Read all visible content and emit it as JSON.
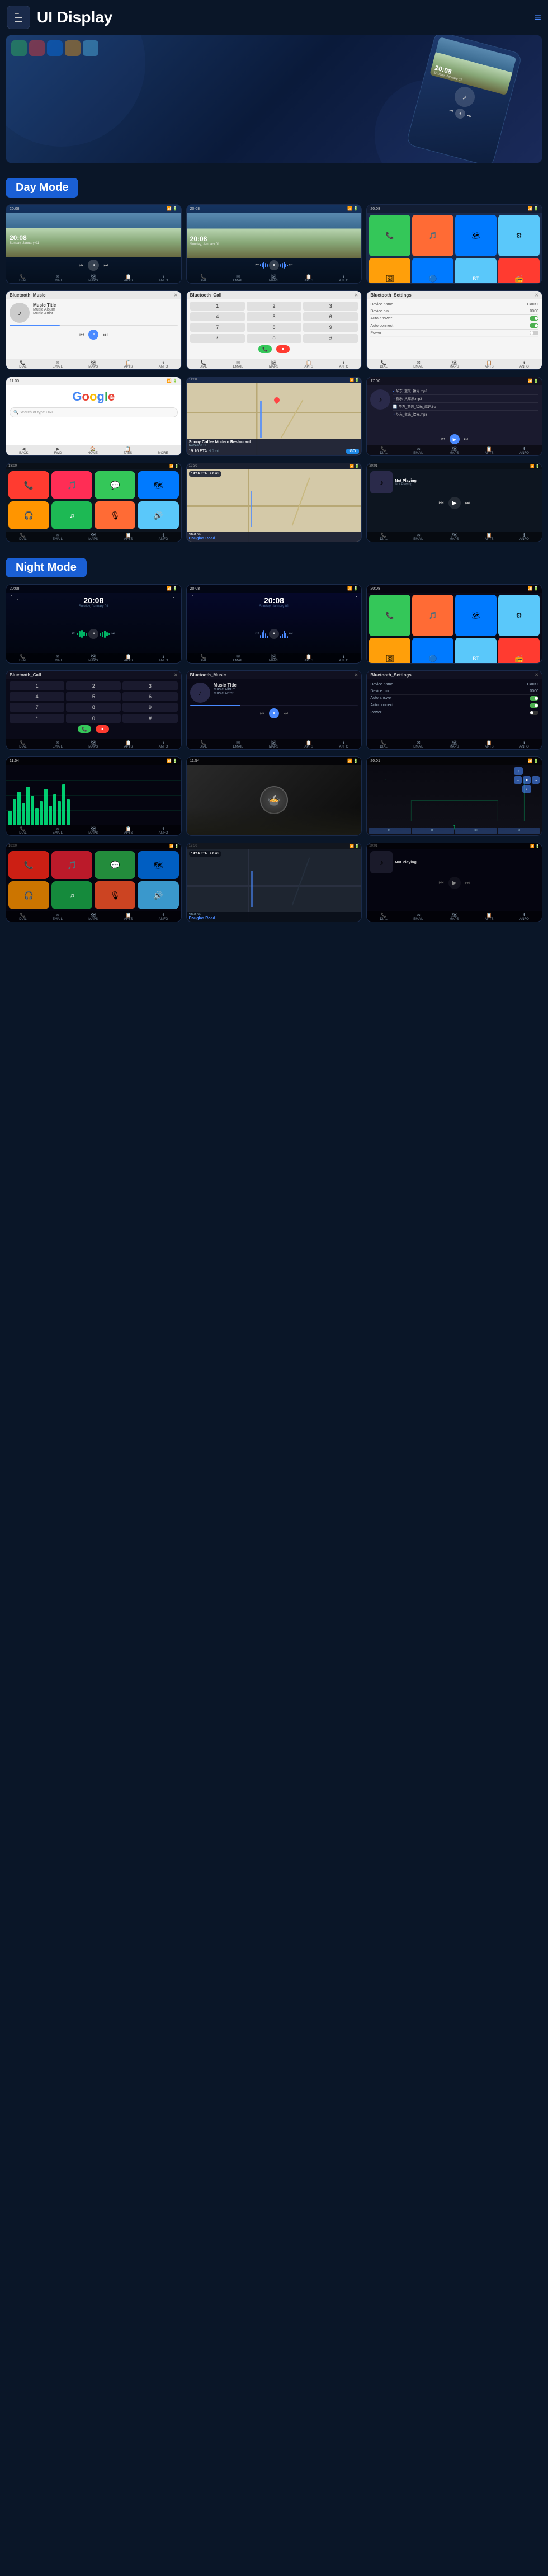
{
  "header": {
    "title": "UI Display",
    "menu_icon": "≡",
    "dots_icon": "⋮"
  },
  "sections": {
    "day_mode": "Day Mode",
    "night_mode": "Night Mode"
  },
  "screens": {
    "home1": {
      "time": "20:08",
      "subtitle": "Sunday, January 01"
    },
    "home2": {
      "time": "20:08",
      "subtitle": "Sunday, January 01"
    },
    "music": {
      "title": "Music Title",
      "album": "Music Album",
      "artist": "Music Artist"
    },
    "bluetooth": {
      "title": "Bluetooth_Music",
      "call": "Bluetooth_Call",
      "settings": "Bluetooth_Settings"
    },
    "settings": {
      "device_name_label": "Device name",
      "device_name_val": "CarBT",
      "device_pin_label": "Device pin",
      "device_pin_val": "0000",
      "auto_answer_label": "Auto answer",
      "auto_connect_label": "Auto connect",
      "power_label": "Power"
    },
    "nav": {
      "restaurant": "Sunny Coffee Modern Restaurant",
      "address": "Robeson St",
      "eta_label": "19:16 ETA",
      "distance": "9.0 mi",
      "go_label": "GO"
    },
    "local_music_files": [
      "华东_蓝光_拾光.mp3",
      "新乐_大草原.mp3",
      "华东_蓝光_拾光_歌词.lrc",
      "华东_蓝光_拾光.mp3"
    ],
    "carplay": {
      "not_playing": "Not Playing",
      "start_on": "Start on",
      "douglas_road": "Douglas Road"
    }
  },
  "bottom_nav": {
    "items": [
      "DIAL",
      "EMAIL",
      "MAPS",
      "APTS",
      "ANFO"
    ]
  },
  "app_colors": {
    "phone": "#34c759",
    "messages": "#34c759",
    "maps": "#ff6b35",
    "music": "#ff2d55",
    "settings": "#8e8e93",
    "safari": "#007aff",
    "photos": "#ff9f0a",
    "mail": "#007aff"
  }
}
